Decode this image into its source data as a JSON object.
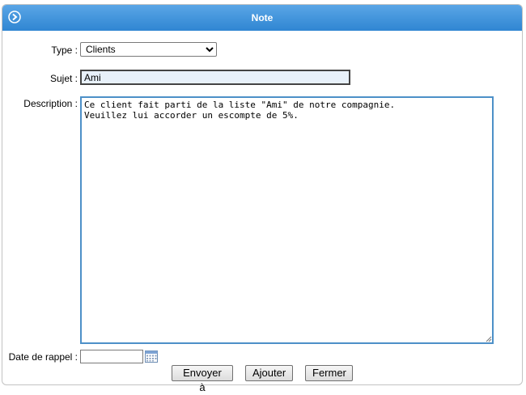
{
  "window": {
    "title": "Note"
  },
  "form": {
    "type_label": "Type :",
    "type_value": "Clients",
    "subject_label": "Sujet :",
    "subject_value": "Ami",
    "description_label": "Description :",
    "description_value": "Ce client fait parti de la liste \"Ami\" de notre compagnie.\nVeuillez lui accorder un escompte de 5%.",
    "reminder_label": "Date de rappel :",
    "reminder_value": ""
  },
  "buttons": {
    "send": "Envoyer à",
    "add": "Ajouter",
    "close": "Fermer"
  },
  "icons": {
    "title": "circle-arrow-icon",
    "calendar": "calendar-icon"
  },
  "colors": {
    "titlebar": "#3a8fd8",
    "subject_bg": "#e8f1fa",
    "focus_border": "#4d90c8"
  }
}
